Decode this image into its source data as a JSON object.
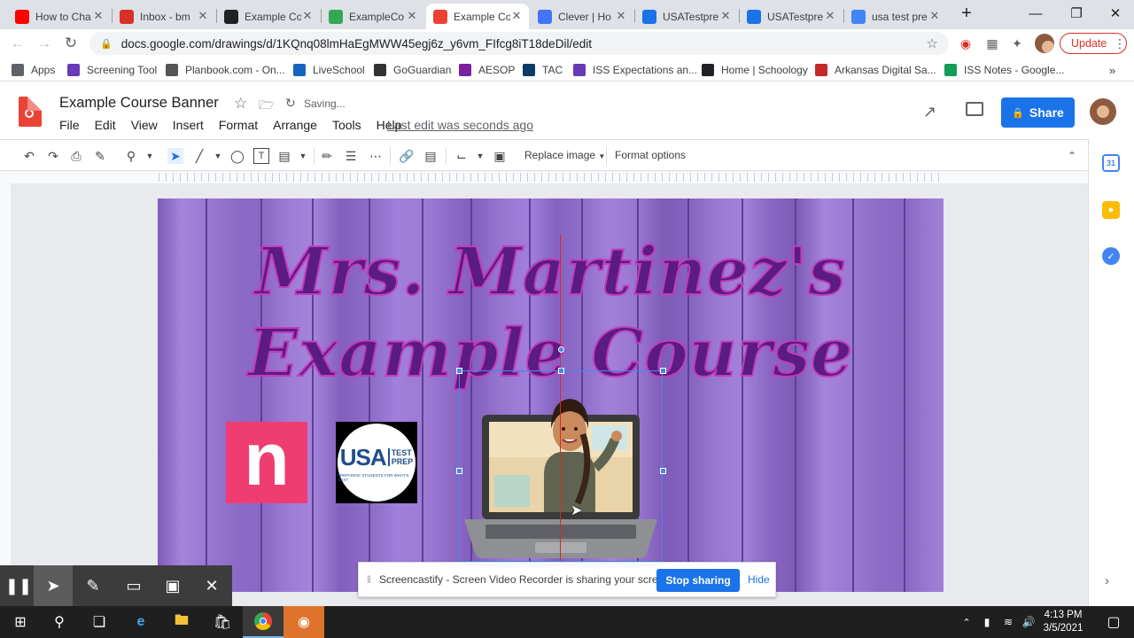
{
  "browser": {
    "tabs": [
      {
        "title": "How to Cha",
        "icon": "youtube-icon",
        "color": "#ff0000"
      },
      {
        "title": "Inbox - bm",
        "icon": "gmail-icon",
        "color": "#d93025"
      },
      {
        "title": "Example Co",
        "icon": "schoology-icon",
        "color": "#202124"
      },
      {
        "title": "ExampleCo",
        "icon": "drive-icon",
        "color": "#34a853"
      },
      {
        "title": "Example Co",
        "icon": "drawings-icon",
        "color": "#ea4335",
        "active": true
      },
      {
        "title": "Clever | Ho",
        "icon": "clever-icon",
        "color": "#4274f6"
      },
      {
        "title": "USATestpre",
        "icon": "cursor-icon",
        "color": "#1a73e8"
      },
      {
        "title": "USATestpre",
        "icon": "cursor-icon",
        "color": "#1a73e8"
      },
      {
        "title": "usa test pre",
        "icon": "google-icon",
        "color": "#4285f4"
      }
    ],
    "new_tab_symbol": "+",
    "url": "docs.google.com/drawings/d/1KQnq08lmHaEgMWW45egj6z_y6vm_FIfcg8iT18deDil/edit",
    "update_label": "Update",
    "bookmarks": [
      {
        "label": "Apps",
        "icon": "apps-grid-icon",
        "color": "#5f6368"
      },
      {
        "label": "Screening Tool",
        "icon": "doc-icon",
        "color": "#673ab7"
      },
      {
        "label": "Planbook.com - On...",
        "icon": "planbook-icon",
        "color": "#555555"
      },
      {
        "label": "LiveSchool",
        "icon": "liveschool-icon",
        "color": "#1565c0"
      },
      {
        "label": "GoGuardian",
        "icon": "shield-icon",
        "color": "#333333"
      },
      {
        "label": "AESOP",
        "icon": "aesop-icon",
        "color": "#7b1fa2"
      },
      {
        "label": "TAC",
        "icon": "tac-icon",
        "color": "#0d3b66"
      },
      {
        "label": "ISS Expectations an...",
        "icon": "form-icon",
        "color": "#673ab7"
      },
      {
        "label": "Home | Schoology",
        "icon": "schoology-icon",
        "color": "#202124"
      },
      {
        "label": "Arkansas Digital Sa...",
        "icon": "vr-icon",
        "color": "#c62828"
      },
      {
        "label": "ISS Notes - Google...",
        "icon": "sheets-icon",
        "color": "#0f9d58"
      }
    ]
  },
  "app": {
    "doc_title": "Example Course Banner",
    "save_status": "Saving...",
    "menus": [
      "File",
      "Edit",
      "View",
      "Insert",
      "Format",
      "Arrange",
      "Tools",
      "Help"
    ],
    "last_edit": "Last edit was seconds ago",
    "share_label": "Share",
    "toolbar": {
      "replace_image": "Replace image",
      "format_options": "Format options"
    }
  },
  "banner": {
    "title_line1": "Mrs. Martinez's",
    "title_line2": "Example Course",
    "n_logo_letter": "n",
    "usa_logo": {
      "big": "USA",
      "side1": "TEST",
      "side2": "PREP",
      "tagline": "PREPARING STUDENTS FOR WHAT'S NEXT"
    }
  },
  "screencastify": {
    "message": "Screencastify - Screen Video Recorder is sharing your screen.",
    "stop_label": "Stop sharing",
    "hide_label": "Hide"
  },
  "taskbar": {
    "time": "4:13 PM",
    "date": "3/5/2021"
  },
  "colors": {
    "accent": "#1a73e8",
    "banner_purple": "#8e6ac9",
    "title_text": "#5a1b82",
    "n_logo_pink": "#ef3d72"
  }
}
